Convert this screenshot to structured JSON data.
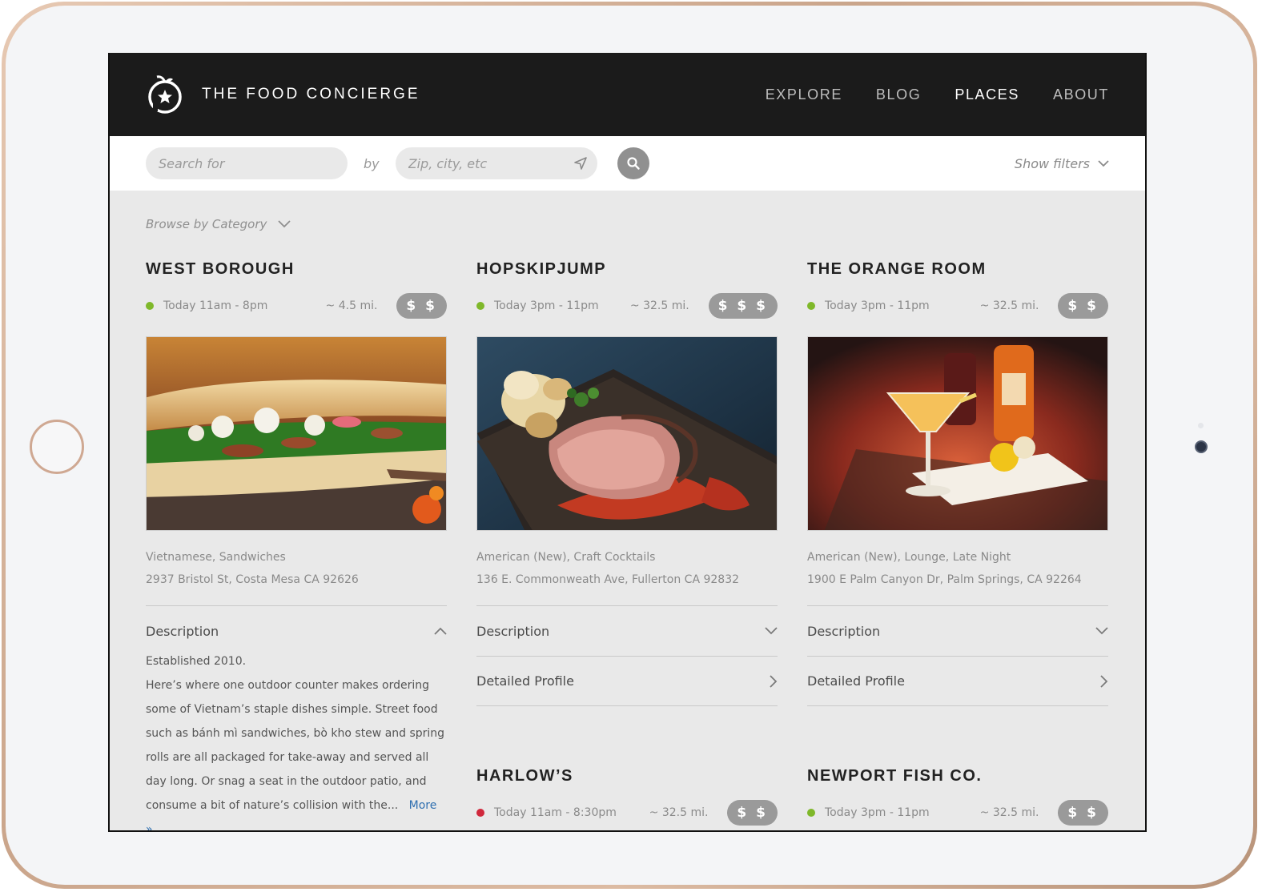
{
  "brand": {
    "name": "THE FOOD CONCIERGE",
    "logo_icon": "apple-star-logo-icon"
  },
  "nav": [
    {
      "label": "EXPLORE",
      "active": false
    },
    {
      "label": "BLOG",
      "active": false
    },
    {
      "label": "PLACES",
      "active": true
    },
    {
      "label": "ABOUT",
      "active": false
    }
  ],
  "search": {
    "query_placeholder": "Search for",
    "by_label": "by",
    "location_placeholder": "Zip, city, etc",
    "show_filters_label": "Show filters"
  },
  "browse_label": "Browse by Category",
  "colors": {
    "open": "#7fb82a",
    "closed": "#d0283c",
    "link": "#2f6fb0",
    "header": "#1b1b1b"
  },
  "places": [
    {
      "name": "WEST BOROUGH",
      "status": "open",
      "hours": "Today  11am - 8pm",
      "distance": "~ 4.5 mi.",
      "price": "$ $",
      "photo": "sandwich-photo",
      "cuisine": "Vietnamese, Sandwiches",
      "address": "2937 Bristol St, Costa Mesa CA 92626",
      "description_label": "Description",
      "description_expanded": true,
      "description_lines": [
        "Established 2010.",
        "Here’s where one outdoor counter makes ordering",
        "some of Vietnam’s staple dishes simple. Street food",
        "such as bánh mì sandwiches, bò kho stew and spring",
        "rolls are all packaged for take-away and served all",
        "day long. Or snag a seat in the outdoor patio, and",
        "consume a bit of nature’s collision with the..."
      ],
      "more_label": "More »"
    },
    {
      "name": "HOPSKIPJUMP",
      "status": "open",
      "hours": "Today  3pm - 11pm",
      "distance": "~ 32.5 mi.",
      "price": "$ $ $",
      "photo": "steak-photo",
      "cuisine": "American (New), Craft Cocktails",
      "address": "136 E. Commonweath Ave, Fullerton CA 92832",
      "description_label": "Description",
      "profile_label": "Detailed Profile"
    },
    {
      "name": "THE ORANGE ROOM",
      "status": "open",
      "hours": "Today  3pm - 11pm",
      "distance": "~ 32.5 mi.",
      "price": "$ $",
      "photo": "cocktail-photo",
      "cuisine": "American (New), Lounge, Late Night",
      "address": "1900 E Palm Canyon Dr, Palm Springs, CA 92264",
      "description_label": "Description",
      "profile_label": "Detailed Profile"
    },
    {
      "name": "HARLOW’S",
      "status": "closed",
      "hours": "Today  11am - 8:30pm",
      "distance": "~ 32.5 mi.",
      "price": "$ $"
    },
    {
      "name": "NEWPORT FISH CO.",
      "status": "open",
      "hours": "Today  3pm - 11pm",
      "distance": "~ 32.5 mi.",
      "price": "$ $"
    }
  ]
}
